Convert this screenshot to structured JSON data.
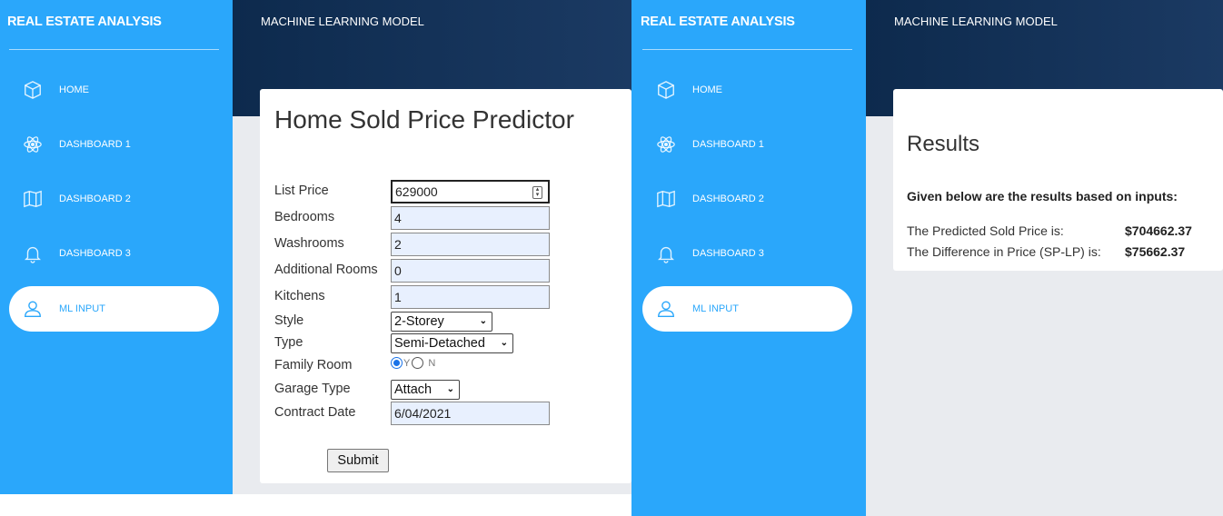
{
  "left": {
    "brand": "REAL ESTATE ANALYSIS",
    "topbar_title": "MACHINE LEARNING MODEL",
    "nav": [
      {
        "label": "HOME",
        "icon": "cube-icon"
      },
      {
        "label": "DASHBOARD 1",
        "icon": "atom-icon"
      },
      {
        "label": "DASHBOARD 2",
        "icon": "map-icon"
      },
      {
        "label": "DASHBOARD 3",
        "icon": "bell-icon"
      },
      {
        "label": "ML INPUT",
        "icon": "user-icon",
        "active": true
      }
    ],
    "form": {
      "title": "Home Sold Price Predictor",
      "fields": {
        "list_price": {
          "label": "List Price",
          "value": "629000"
        },
        "bedrooms": {
          "label": "Bedrooms",
          "value": "4"
        },
        "washrooms": {
          "label": "Washrooms",
          "value": "2"
        },
        "additional_rooms": {
          "label": "Additional Rooms",
          "value": "0"
        },
        "kitchens": {
          "label": "Kitchens",
          "value": "1"
        },
        "style": {
          "label": "Style",
          "value": "2-Storey"
        },
        "type": {
          "label": "Type",
          "value": "Semi-Detached"
        },
        "family_room": {
          "label": "Family Room",
          "option_y": "Y",
          "option_n": "N",
          "selected": "Y"
        },
        "garage_type": {
          "label": "Garage Type",
          "value": "Attach"
        },
        "contract_date": {
          "label": "Contract Date",
          "value": "6/04/2021"
        }
      },
      "submit_label": "Submit"
    }
  },
  "right": {
    "brand": "REAL ESTATE ANALYSIS",
    "topbar_title": "MACHINE LEARNING MODEL",
    "nav": [
      {
        "label": "HOME",
        "icon": "cube-icon"
      },
      {
        "label": "DASHBOARD 1",
        "icon": "atom-icon"
      },
      {
        "label": "DASHBOARD 2",
        "icon": "map-icon"
      },
      {
        "label": "DASHBOARD 3",
        "icon": "bell-icon"
      },
      {
        "label": "ML INPUT",
        "icon": "user-icon",
        "active": true
      }
    ],
    "results": {
      "title": "Results",
      "subtitle": "Given below are the results based on inputs:",
      "predicted_label": "The Predicted Sold Price is:",
      "predicted_value": "$704662.37",
      "difference_label": "The Difference in Price (SP-LP) is:",
      "difference_value": "$75662.37"
    }
  },
  "colors": {
    "sidebar": "#2aa7fb",
    "topbar": "#0d2a4d",
    "main_bg": "#e9ebef",
    "input_bg": "#e8f0fe"
  }
}
